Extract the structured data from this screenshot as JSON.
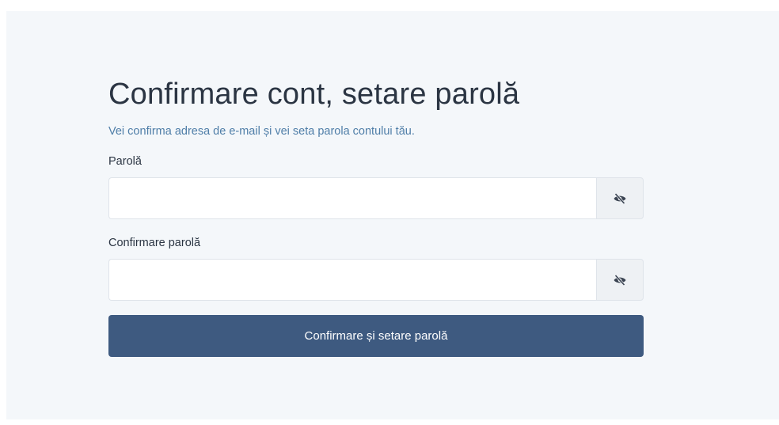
{
  "form": {
    "title": "Confirmare cont, setare parolă",
    "subtitle": "Vei confirma adresa de e-mail și vei seta parola contului tău.",
    "password": {
      "label": "Parolă",
      "value": "",
      "toggle_icon": "eye-slash-icon"
    },
    "confirm_password": {
      "label": "Confirmare parolă",
      "value": "",
      "toggle_icon": "eye-slash-icon"
    },
    "submit_label": "Confirmare și setare parolă"
  },
  "colors": {
    "panel_background": "#f4f7fa",
    "title": "#2b3543",
    "subtitle_link": "#4f7ea8",
    "button_primary": "#3e5a80",
    "toggle_background": "#eef1f4"
  }
}
